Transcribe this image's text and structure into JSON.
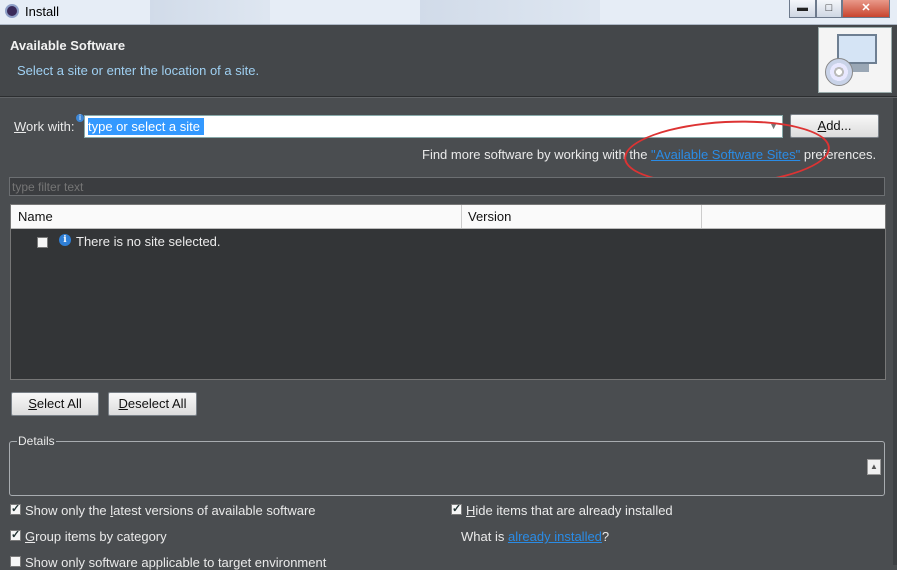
{
  "window": {
    "title": "Install",
    "minimize": "▬",
    "maximize": "□",
    "close": "✕"
  },
  "header": {
    "title": "Available Software",
    "subtitle": "Select a site or enter the location of a site.",
    "banner_icon": "cd-monitor-icon"
  },
  "work_with": {
    "label_prefix": "W",
    "label_rest": "ork with:",
    "value": "type or select a site",
    "info_badge": "i",
    "add_button": {
      "mnemonic": "A",
      "rest": "dd..."
    }
  },
  "find_more": {
    "prefix": "Find more software by working with the ",
    "link": "\"Available Software Sites\"",
    "suffix": " preferences."
  },
  "filter": {
    "placeholder": "type filter text"
  },
  "table": {
    "columns": [
      "Name",
      "Version"
    ],
    "rows": [
      {
        "checked": false,
        "icon": "info-icon",
        "name": "There is no site selected."
      }
    ]
  },
  "buttons": {
    "select_all": {
      "mnemonic": "S",
      "rest": "elect All"
    },
    "deselect_all": {
      "mnemonic": "D",
      "rest": "eselect All"
    }
  },
  "details": {
    "legend": "Details"
  },
  "options": {
    "latest_versions": {
      "checked": true,
      "before": "Show only the ",
      "mnemonic": "l",
      "after": "atest versions of available software"
    },
    "hide_installed": {
      "checked": true,
      "mnemonic": "H",
      "after": "ide items that are already installed"
    },
    "group_by_category": {
      "checked": true,
      "mnemonic": "G",
      "after": "roup items by category"
    },
    "what_is": {
      "prefix": "What is ",
      "link": "already installed",
      "suffix": "?"
    },
    "applicable_target": {
      "checked": false,
      "text": "Show only software applicable to target environment"
    }
  },
  "colors": {
    "background": "#4a4d50",
    "header_background": "#44474a",
    "subtitle": "#9fd0f2",
    "link": "#2a8ce6",
    "selection": "#3399ff",
    "annotation": "#dd3333"
  }
}
